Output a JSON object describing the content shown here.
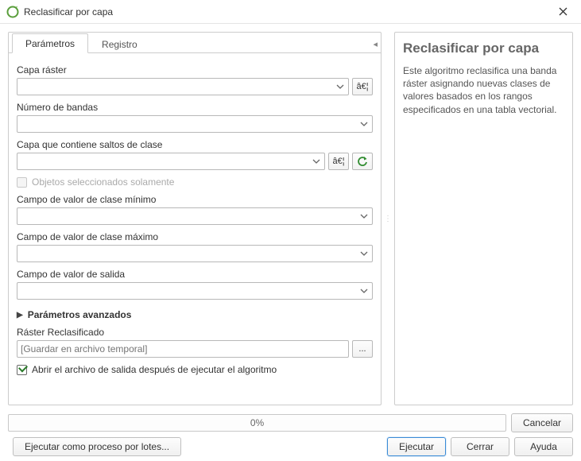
{
  "window": {
    "title": "Reclasificar por capa"
  },
  "tabs": {
    "parameters": "Parámetros",
    "log": "Registro"
  },
  "labels": {
    "raster_layer": "Capa ráster",
    "band_number": "Número de bandas",
    "class_breaks_layer": "Capa que contiene saltos de clase",
    "selected_only": "Objetos seleccionados solamente",
    "min_field": "Campo de valor de clase mínimo",
    "max_field": "Campo de valor de clase máximo",
    "output_field": "Campo de valor de salida",
    "advanced": "Parámetros avanzados",
    "reclassified": "Ráster Reclasificado",
    "open_after": "Abrir el archivo de salida después de ejecutar el algoritmo"
  },
  "placeholders": {
    "save_temp": "[Guardar en archivo temporal]"
  },
  "buttons": {
    "ellipsis": "â€¦",
    "ellipsis2": "...",
    "cancel": "Cancelar",
    "batch": "Ejecutar como proceso por lotes...",
    "run": "Ejecutar",
    "close": "Cerrar",
    "help": "Ayuda"
  },
  "progress": {
    "text": "0%"
  },
  "help": {
    "title": "Reclasificar por capa",
    "body": "Este algoritmo reclasifica una banda ráster asignando nuevas clases de valores basados en los rangos especificados en una tabla vectorial."
  }
}
